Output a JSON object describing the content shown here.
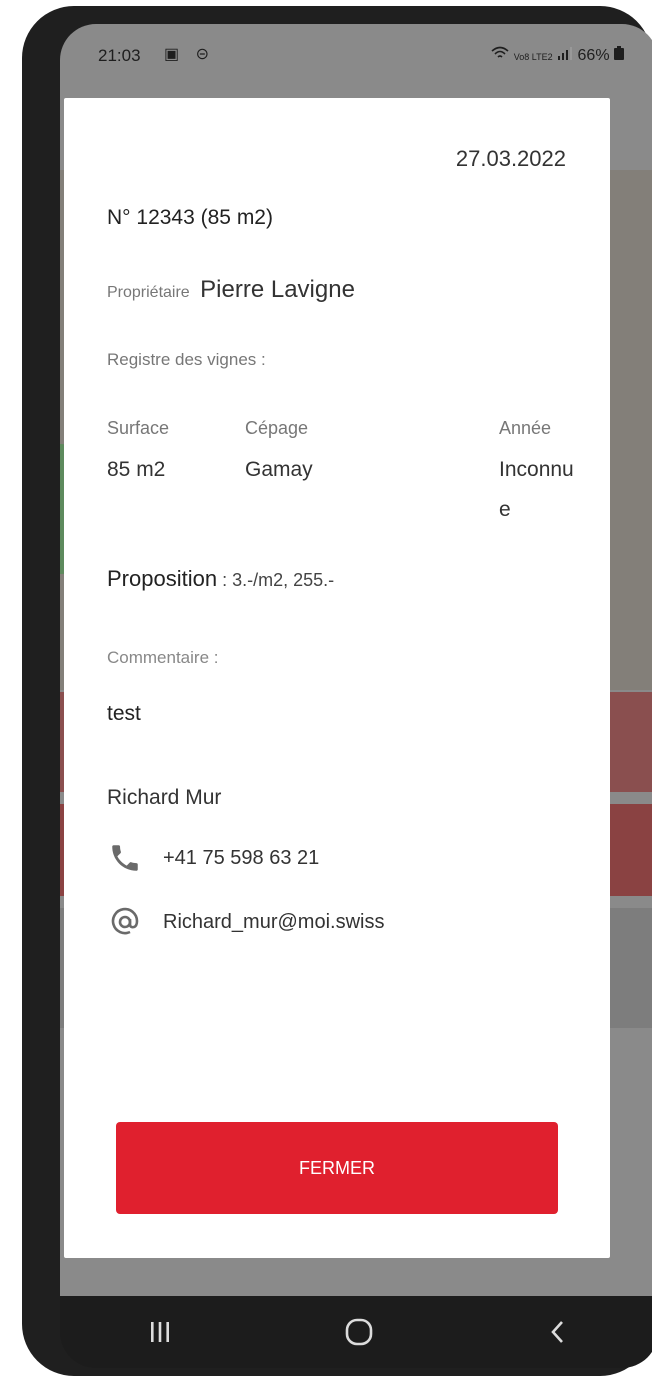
{
  "status_bar": {
    "time": "21:03",
    "left_icons": "▣ ⊝",
    "signal_label": "Vo8 LTE2",
    "battery": "66%"
  },
  "modal": {
    "date": "27.03.2022",
    "parcel": "N° 12343 (85 m2)",
    "owner_label": "Propriétaire",
    "owner_name": "Pierre Lavigne",
    "registry_label": "Registre des vignes :",
    "columns": [
      {
        "header": "Surface",
        "value": "85 m2"
      },
      {
        "header": "Cépage",
        "value": "Gamay"
      },
      {
        "header": "Année",
        "value": "Inconnue"
      }
    ],
    "proposition_label": "Proposition",
    "proposition_value": " : 3.-/m2, 255.-",
    "comment_label": "Commentaire :",
    "comment_value": "test",
    "contact_name": "Richard Mur",
    "contact_phone": "+41 75 598 63 21",
    "contact_email": "Richard_mur@moi.swiss",
    "close_button": "FERMER"
  },
  "colors": {
    "accent_red": "#e0202e",
    "overlay": "#8a8a8a"
  },
  "icons": {
    "phone": "phone-icon",
    "email": "at-icon",
    "nav_recent": "recent-apps-icon",
    "nav_home": "home-icon",
    "nav_back": "back-icon"
  }
}
